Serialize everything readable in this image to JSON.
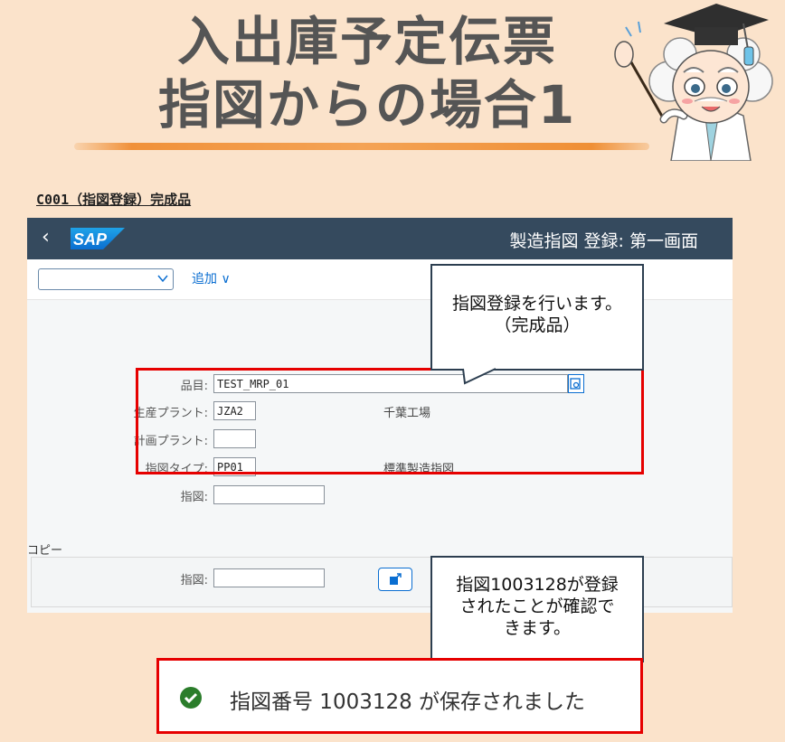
{
  "header": {
    "title_line1": "入出庫予定伝票",
    "title_line2": "指図からの場合1"
  },
  "section_label": "C001（指図登録）完成品",
  "sap": {
    "app_title": "製造指図 登録: 第一画面",
    "logo_text": "SAP",
    "add_menu_label": "追加",
    "fields": {
      "material_label": "品目:",
      "material_value": "TEST_MRP_01",
      "production_plant_label": "生産プラント:",
      "production_plant_value": "JZA2",
      "production_plant_desc": "千葉工場",
      "planning_plant_label": "計画プラント:",
      "planning_plant_value": "",
      "order_type_label": "指図タイプ:",
      "order_type_value": "PP01",
      "order_type_desc": "標準製造指図",
      "order_label": "指図:",
      "order_value": ""
    },
    "copy": {
      "section_label": "コピー",
      "order_label": "指図:",
      "order_value": ""
    }
  },
  "callout1": {
    "line1": "指図登録を行います。",
    "line2": "（完成品）"
  },
  "callout2": {
    "line1": "指図1003128が登録",
    "line2": "されたことが確認で",
    "line3": "きます。"
  },
  "status_message": "指図番号 1003128 が保存されました",
  "colors": {
    "background": "#fbe3cb",
    "sap_header": "#354a5e",
    "highlight_red": "#e60000",
    "success_green": "#2b7d2b"
  }
}
